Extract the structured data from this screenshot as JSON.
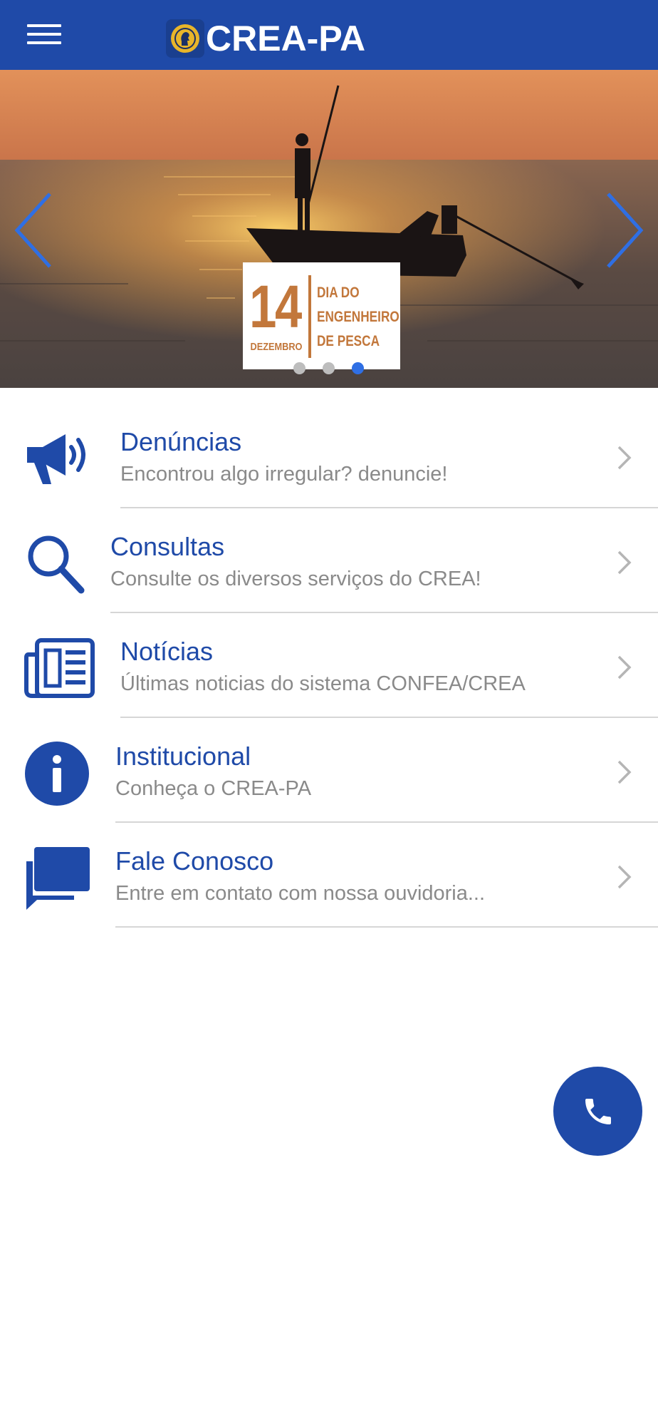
{
  "header": {
    "menu_icon": "hamburger-menu-icon",
    "logo_icon": "crea-emblem-icon",
    "logo_text": "CREA-PA",
    "background_color": "#1f4aa8"
  },
  "banner": {
    "promo_number": "14",
    "promo_month": "DEZEMBRO",
    "promo_title_lines": [
      "DIA DO",
      "ENGENHEIRO",
      "DE PESCA"
    ],
    "prev_icon": "chevron-left-icon",
    "next_icon": "chevron-right-icon",
    "slide_count": 3,
    "active_slide": 3,
    "arrow_color": "#2f6fe4"
  },
  "menu": {
    "items": [
      {
        "title": "Denúncias",
        "subtitle": "Encontrou algo irregular? denuncie!",
        "icon": "megaphone-icon"
      },
      {
        "title": "Consultas",
        "subtitle": "Consulte os diversos serviços do CREA!",
        "icon": "search-icon"
      },
      {
        "title": "Notícias",
        "subtitle": "Últimas noticias do sistema CONFEA/CREA",
        "icon": "newspaper-icon"
      },
      {
        "title": "Institucional",
        "subtitle": "Conheça o CREA-PA",
        "icon": "info-icon"
      },
      {
        "title": "Fale Conosco",
        "subtitle": "Entre em contato com nossa ouvidoria...",
        "icon": "chat-icon"
      }
    ],
    "chevron_icon": "chevron-right-icon",
    "accent_color": "#1f4aa8",
    "subtitle_color": "#8a8a8a"
  },
  "fab": {
    "icon": "phone-icon",
    "color": "#1f4aa8"
  }
}
